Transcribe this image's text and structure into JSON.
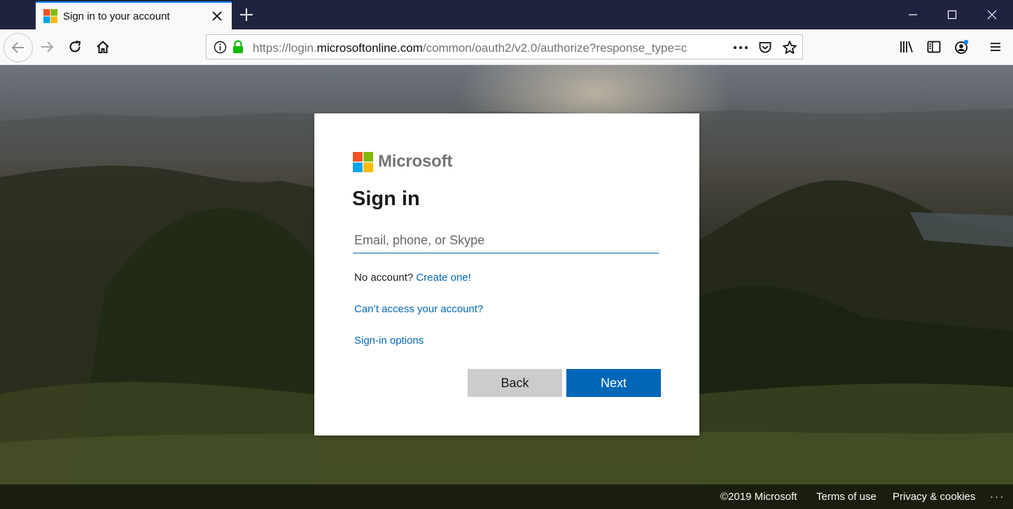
{
  "browser": {
    "tab": {
      "title": "Sign in to your account"
    },
    "url": {
      "prefix": "https://login.",
      "host": "microsoftonline.com",
      "path": "/common/oauth2/v2.0/authorize?response_type=c"
    }
  },
  "card": {
    "brand": "Microsoft",
    "title": "Sign in",
    "email_placeholder": "Email, phone, or Skype",
    "no_account_text": "No account?",
    "create_link": "Create one!",
    "cant_access_link": "Can’t access your account?",
    "signin_options_link": "Sign-in options",
    "back_label": "Back",
    "next_label": "Next"
  },
  "footer": {
    "copyright": "©2019 Microsoft",
    "terms": "Terms of use",
    "privacy": "Privacy & cookies",
    "more": "· · ·"
  },
  "colors": {
    "accent": "#0067b8",
    "logo_red": "#f25022",
    "logo_green": "#7fba00",
    "logo_blue": "#00a4ef",
    "logo_yellow": "#ffb900",
    "tab_strip": "#202340"
  }
}
